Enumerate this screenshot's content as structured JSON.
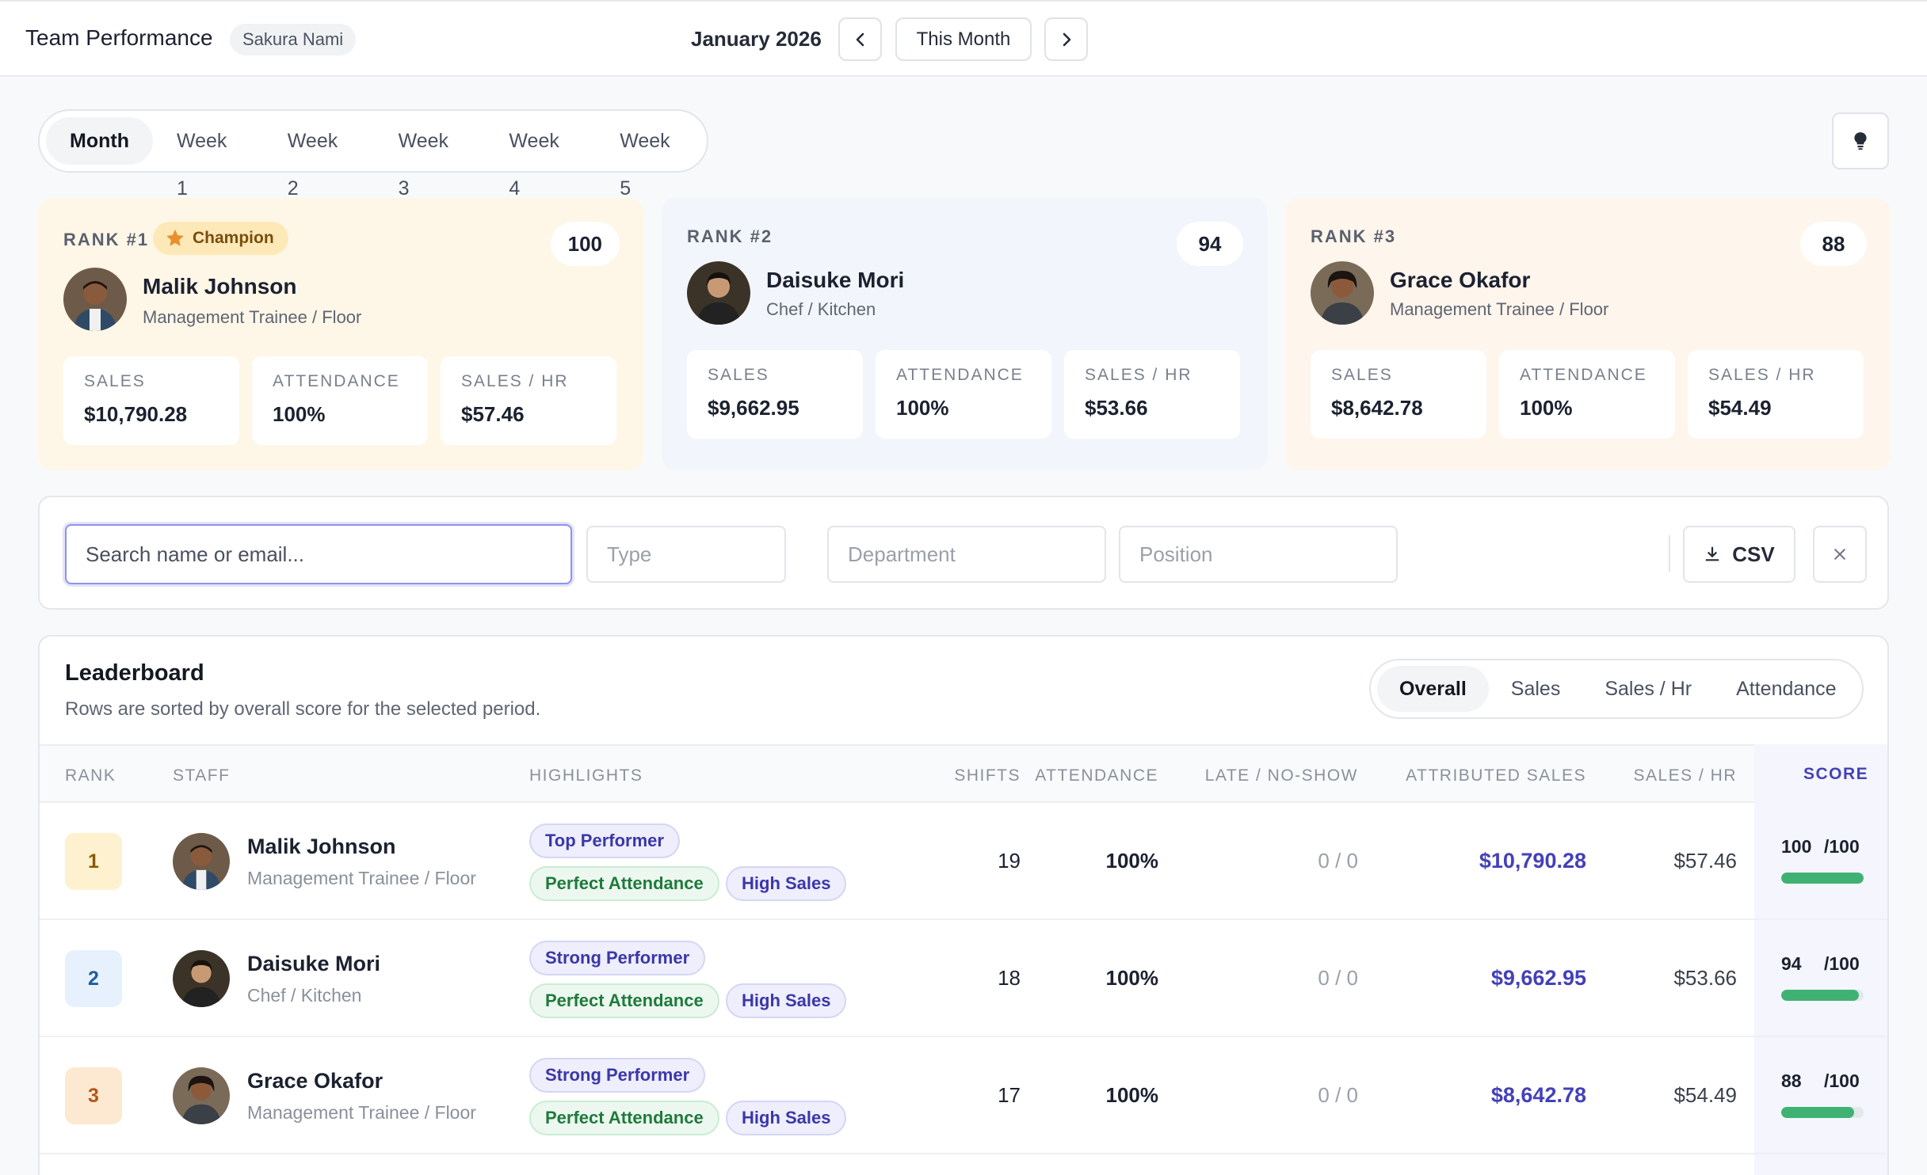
{
  "header": {
    "title": "Team Performance",
    "user": "Sakura Nami",
    "period": "January 2026",
    "this_month_label": "This Month"
  },
  "period_tabs": [
    "Month",
    "Week 1",
    "Week 2",
    "Week 3",
    "Week 4",
    "Week 5"
  ],
  "podium": [
    {
      "rank_label": "RANK #1",
      "badge": "Champion",
      "score": "100",
      "name": "Malik Johnson",
      "role": "Management Trainee / Floor",
      "stats": [
        {
          "label": "SALES",
          "value": "$10,790.28"
        },
        {
          "label": "ATTENDANCE",
          "value": "100%"
        },
        {
          "label": "SALES / HR",
          "value": "$57.46"
        }
      ]
    },
    {
      "rank_label": "RANK #2",
      "score": "94",
      "name": "Daisuke Mori",
      "role": "Chef / Kitchen",
      "stats": [
        {
          "label": "SALES",
          "value": "$9,662.95"
        },
        {
          "label": "ATTENDANCE",
          "value": "100%"
        },
        {
          "label": "SALES / HR",
          "value": "$53.66"
        }
      ]
    },
    {
      "rank_label": "RANK #3",
      "score": "88",
      "name": "Grace Okafor",
      "role": "Management Trainee / Floor",
      "stats": [
        {
          "label": "SALES",
          "value": "$8,642.78"
        },
        {
          "label": "ATTENDANCE",
          "value": "100%"
        },
        {
          "label": "SALES / HR",
          "value": "$54.49"
        }
      ]
    }
  ],
  "filters": {
    "search_placeholder": "Search name or email...",
    "type": "Type",
    "department": "Department",
    "position": "Position",
    "csv_label": "CSV"
  },
  "leaderboard": {
    "title": "Leaderboard",
    "subtitle": "Rows are sorted by overall score for the selected period.",
    "metric_tabs": [
      "Overall",
      "Sales",
      "Sales / Hr",
      "Attendance"
    ],
    "columns": [
      "RANK",
      "STAFF",
      "HIGHLIGHTS",
      "SHIFTS",
      "ATTENDANCE",
      "LATE / NO-SHOW",
      "ATTRIBUTED SALES",
      "SALES / HR",
      "SCORE"
    ],
    "rows": [
      {
        "rank": "1",
        "name": "Malik Johnson",
        "role": "Management Trainee / Floor",
        "tags": [
          "Top Performer",
          "Perfect Attendance",
          "High Sales"
        ],
        "shifts": "19",
        "attendance": "100%",
        "late": "0 / 0",
        "sales": "$10,790.28",
        "sales_hr": "$57.46",
        "score": "100",
        "score_of": "/100",
        "score_fraction": 1.0
      },
      {
        "rank": "2",
        "name": "Daisuke Mori",
        "role": "Chef / Kitchen",
        "tags": [
          "Strong Performer",
          "Perfect Attendance",
          "High Sales"
        ],
        "shifts": "18",
        "attendance": "100%",
        "late": "0 / 0",
        "sales": "$9,662.95",
        "sales_hr": "$53.66",
        "score": "94",
        "score_of": "/100",
        "score_fraction": 0.94
      },
      {
        "rank": "3",
        "name": "Grace Okafor",
        "role": "Management Trainee / Floor",
        "tags": [
          "Strong Performer",
          "Perfect Attendance",
          "High Sales"
        ],
        "shifts": "17",
        "attendance": "100%",
        "late": "0 / 0",
        "sales": "$8,642.78",
        "sales_hr": "$54.49",
        "score": "88",
        "score_of": "/100",
        "score_fraction": 0.88
      }
    ]
  },
  "colors": {
    "accent": "#4341b8",
    "success": "#3fb273",
    "rank1": "#fdf1cf",
    "rank2": "#e6f1fd",
    "rank3": "#fde8d2"
  }
}
